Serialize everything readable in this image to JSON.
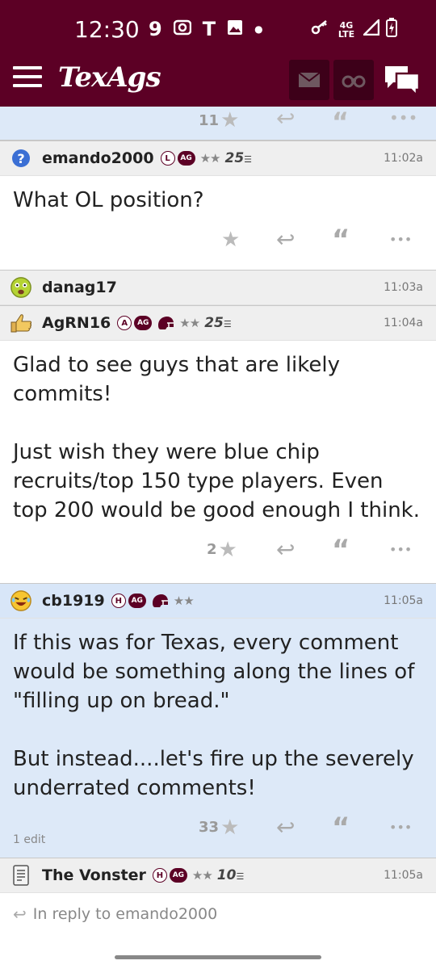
{
  "status_bar": {
    "time": "12:30",
    "left_icons": [
      "9",
      "T"
    ],
    "network": "4G LTE"
  },
  "app_bar": {
    "logo": "TexAgs"
  },
  "top_actions": {
    "count": "11"
  },
  "posts": [
    {
      "username": "emando2000",
      "badges": [
        "L"
      ],
      "ag": "AG",
      "stars": "★★",
      "points": "25",
      "time": "11:02a",
      "body": [
        "What OL position?"
      ],
      "count": ""
    },
    {
      "username": "danag17",
      "time": "11:03a"
    },
    {
      "username": "AgRN16",
      "badges": [
        "A"
      ],
      "ag": "AG",
      "stars": "★★",
      "points": "25",
      "time": "11:04a",
      "body": [
        "Glad to see guys that are likely commits!",
        "Just wish they were blue chip recruits/top 150 type players. Even top 200 would be good enough I think."
      ],
      "count": "2"
    },
    {
      "username": "cb1919",
      "badges": [
        "H"
      ],
      "ag": "AG",
      "stars": "★★",
      "time": "11:05a",
      "body": [
        "If this was for Texas, every comment would be something along the lines of \"filling up on bread.\"",
        "But instead....let's fire up the severely underrated comments!"
      ],
      "count": "33",
      "edit": "1 edit"
    },
    {
      "username": "The Vonster",
      "badges": [
        "H"
      ],
      "ag": "AG",
      "stars": "★★",
      "points": "10",
      "time": "11:05a",
      "reply_to": "In reply to emando2000"
    }
  ],
  "colors": {
    "maroon": "#5c0025",
    "highlight": "#dde9f8"
  }
}
